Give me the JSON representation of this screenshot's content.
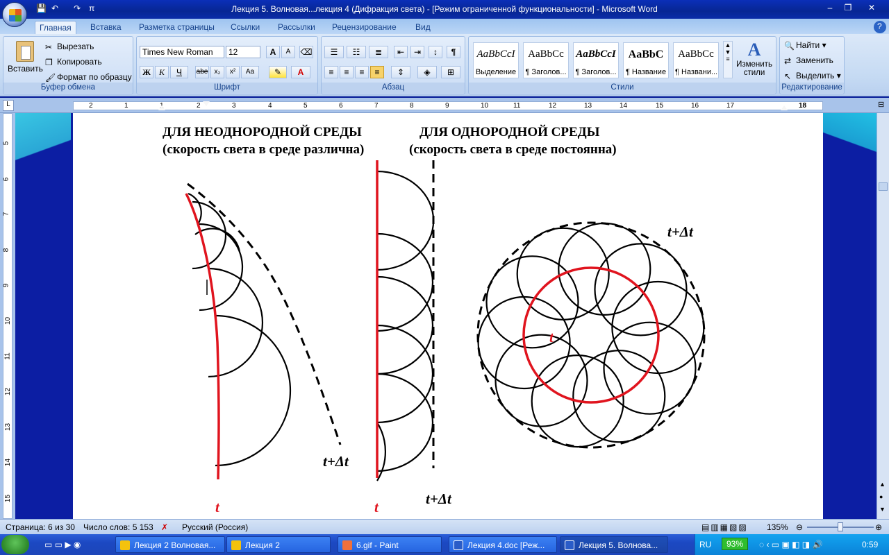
{
  "window": {
    "title": "Лекция 5. Волновая...лекция 4 (Дифракция света) - [Режим ограниченной функциональности] - Microsoft Word",
    "min": "–",
    "max": "❐",
    "close": "✕"
  },
  "qat": [
    "save",
    "undo",
    "redo",
    "pi"
  ],
  "tabs": [
    "Главная",
    "Вставка",
    "Разметка страницы",
    "Ссылки",
    "Рассылки",
    "Рецензирование",
    "Вид"
  ],
  "clipboard": {
    "paste": "Вставить",
    "cut": "Вырезать",
    "copy": "Копировать",
    "format_painter": "Формат по образцу",
    "label": "Буфер обмена"
  },
  "font": {
    "family": "Times New Roman",
    "size": "12",
    "label": "Шрифт",
    "bold": "Ж",
    "italic": "К",
    "underline": "Ч",
    "strike": "abe",
    "sub": "x₂",
    "sup": "x²",
    "case": "Aa",
    "grow": "A",
    "shrink": "A"
  },
  "paragraph": {
    "label": "Абзац",
    "pilcrow": "¶"
  },
  "styles": {
    "label": "Стили",
    "tiles": [
      {
        "preview": "AaBbCcI",
        "name": "Выделение"
      },
      {
        "preview": "AaBbCc",
        "name": "¶ Заголов..."
      },
      {
        "preview": "AaBbCcI",
        "name": "¶ Заголов..."
      },
      {
        "preview": "AaBbC",
        "name": "¶ Название"
      },
      {
        "preview": "AaBbCc",
        "name": "¶ Названи..."
      }
    ],
    "change": "Изменить стили"
  },
  "editing": {
    "label": "Редактирование",
    "find": "Найти",
    "replace": "Заменить",
    "select": "Выделить"
  },
  "ruler_numbers": [
    "2",
    "1",
    "1",
    "2",
    "3",
    "4",
    "5",
    "6",
    "7",
    "8",
    "9",
    "10",
    "11",
    "12",
    "13",
    "14",
    "15",
    "16",
    "17",
    "18"
  ],
  "vruler_numbers": [
    "5",
    "6",
    "7",
    "8",
    "9",
    "10",
    "11",
    "12",
    "13",
    "14",
    "15"
  ],
  "document": {
    "left_heading": "ДЛЯ НЕОДНОРОДНОЙ СРЕДЫ",
    "left_sub": "(скорость света в среде различна)",
    "right_heading": "ДЛЯ ОДНОРОДНОЙ СРЕДЫ",
    "right_sub": "(скорость света в среде постоянна)",
    "label_t": "t",
    "label_tdt": "t+Δt",
    "colors": {
      "front": "#e0141e",
      "ink": "#000000"
    }
  },
  "status": {
    "page": "Страница: 6 из 30",
    "words": "Число слов: 5 153",
    "lang": "Русский (Россия)",
    "zoom": "135%"
  },
  "taskbar": {
    "tasks": [
      "Лекция 2 Волновая...",
      "Лекция 2",
      "6.gif - Paint",
      "Лекция 4.doc [Реж...",
      "Лекция 5. Волнова..."
    ],
    "lang": "RU",
    "battery": "93%",
    "clock": "0:59"
  }
}
